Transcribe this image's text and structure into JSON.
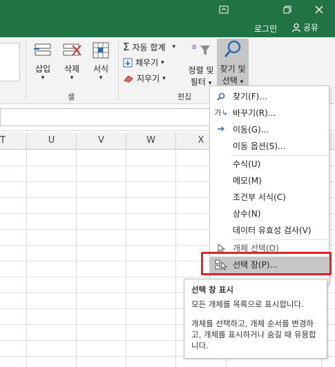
{
  "window": {
    "restore_icon": "⊡",
    "min_icon": "🗗",
    "close_icon": "✕"
  },
  "account": {
    "login": "로그인",
    "share": "공유"
  },
  "ribbon": {
    "cells": {
      "insert": "삽입",
      "delete": "삭제",
      "format": "서식",
      "group": "셀"
    },
    "editing": {
      "autosum": "자동 합계",
      "fill": "채우기",
      "clear": "지우기",
      "sort_line1": "정렬 및",
      "sort_line2": "필터",
      "find_line1": "찾기 및",
      "find_line2": "선택",
      "group": "편집"
    }
  },
  "columns": [
    "T",
    "U",
    "V",
    "W",
    "X"
  ],
  "menu": {
    "items": [
      {
        "label": "찾기(F)...",
        "icon": "search-icon"
      },
      {
        "label": "바꾸기(R)...",
        "icon": "replace-icon"
      },
      {
        "label": "이동(G)...",
        "icon": "arrow-right-icon"
      },
      {
        "label": "이동 옵션(S)..."
      },
      {
        "label": "수식(U)"
      },
      {
        "label": "메모(M)"
      },
      {
        "label": "조건부 서식(C)"
      },
      {
        "label": "상수(N)"
      },
      {
        "label": "데이터 유효성 검사(V)"
      },
      {
        "label": "개체 선택(O)",
        "icon": "pointer-icon"
      },
      {
        "label": "선택 창(P)...",
        "icon": "selection-pane-icon"
      }
    ]
  },
  "tooltip": {
    "title": "선택 창 표시",
    "desc1": "모든 개체를 목록으로 표시합니다.",
    "desc2": "개체를 선택하고, 개체 순서를 변경하고, 개체를 표시하거나 숨길 때 유용합니다."
  },
  "colors": {
    "titlebar": "#217346",
    "highlight": "#e52126",
    "accent": "#2b6cb0"
  }
}
